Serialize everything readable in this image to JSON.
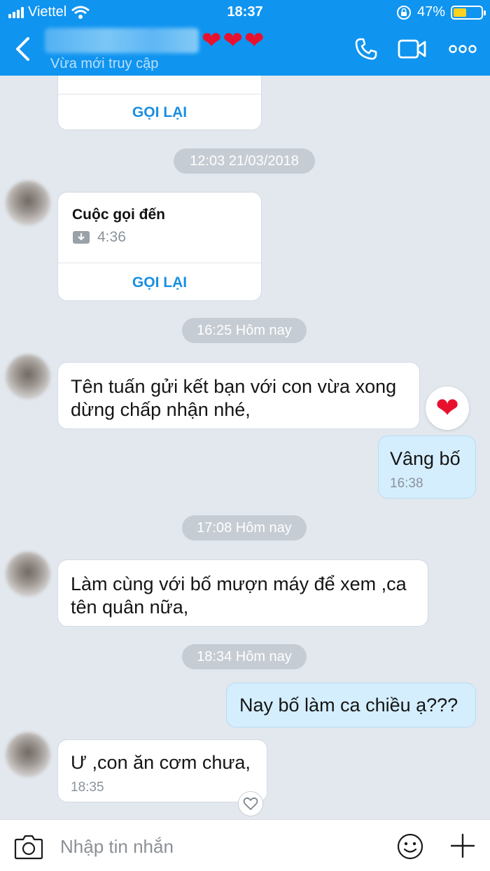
{
  "status_bar": {
    "carrier": "Viettel",
    "time": "18:37",
    "battery": "47%",
    "battery_level": 0.47
  },
  "header": {
    "subtitle": "Vừa mới truy cập",
    "hearts": "❤❤❤"
  },
  "messages": {
    "call_1": {
      "action": "GỌI LẠI"
    },
    "sep_1": "12:03 21/03/2018",
    "call_2": {
      "title": "Cuộc gọi đến",
      "duration": "4:36",
      "action": "GỌI LẠI"
    },
    "sep_2": "16:25 Hôm nay",
    "msg_1": {
      "line1": "Tên tuấn gửi kết bạn với con vừa xong",
      "line2": "dừng chấp nhận nhé,",
      "reaction": "❤"
    },
    "msg_2": {
      "text": "Vâng bố",
      "time": "16:38"
    },
    "sep_3": "17:08 Hôm nay",
    "msg_3": {
      "line1": "Làm cùng với bố mượn máy để xem ,ca",
      "line2": "tên quân nữa,"
    },
    "sep_4": "18:34 Hôm nay",
    "msg_4": {
      "text": "Nay bố làm ca chiều ạ???"
    },
    "msg_5": {
      "text": "Ư ,con ăn cơm chưa,",
      "time": "18:35"
    }
  },
  "input": {
    "placeholder": "Nhập tin nhắn",
    "value": ""
  },
  "colors": {
    "header": "#0f94f0",
    "chat_bg": "#e2e8ee",
    "my_bubble": "#d5eefe",
    "link_blue": "#1a8fe0"
  },
  "icons": [
    "back-arrow-icon",
    "phone-icon",
    "video-call-icon",
    "more-icon",
    "download-call-icon",
    "heart-outline-icon",
    "camera-icon",
    "smile-icon",
    "plus-icon"
  ]
}
